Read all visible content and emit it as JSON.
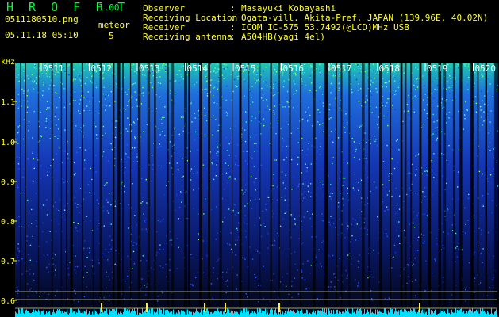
{
  "header": {
    "app_title": "H R O F F T",
    "app_version": "1.00",
    "file_name": "0511180510.png",
    "datetime": "05.11.18 05:10",
    "meteor_label": "meteor",
    "meteor_count": "5"
  },
  "station_info": [
    {
      "label": "Observer",
      "value": "Masayuki Kobayashi"
    },
    {
      "label": "Receiving Location",
      "value": "Ogata-vill. Akita-Pref. JAPAN (139.96E, 40.02N)"
    },
    {
      "label": "Receiver",
      "value": "ICOM IC-575 53.7492(@LCD)MHz USB"
    },
    {
      "label": "Receiving antenna",
      "value": "A504HB(yagi 4el)"
    }
  ],
  "spectrogram": {
    "unit_label": "kHz",
    "time_ticks": [
      "0511",
      "0512",
      "0513",
      "0514",
      "0515",
      "0516",
      "0517",
      "0518",
      "0519",
      "0520"
    ],
    "freq_ticks": [
      "1.1",
      "1.0",
      "0.9",
      "0.8",
      "0.7",
      "0.6"
    ],
    "colors": {
      "axis_text": "#ffff30",
      "tick_text": "#ffffff",
      "grid": "#c8c878",
      "baseline_noise": "#00e0ff"
    }
  }
}
